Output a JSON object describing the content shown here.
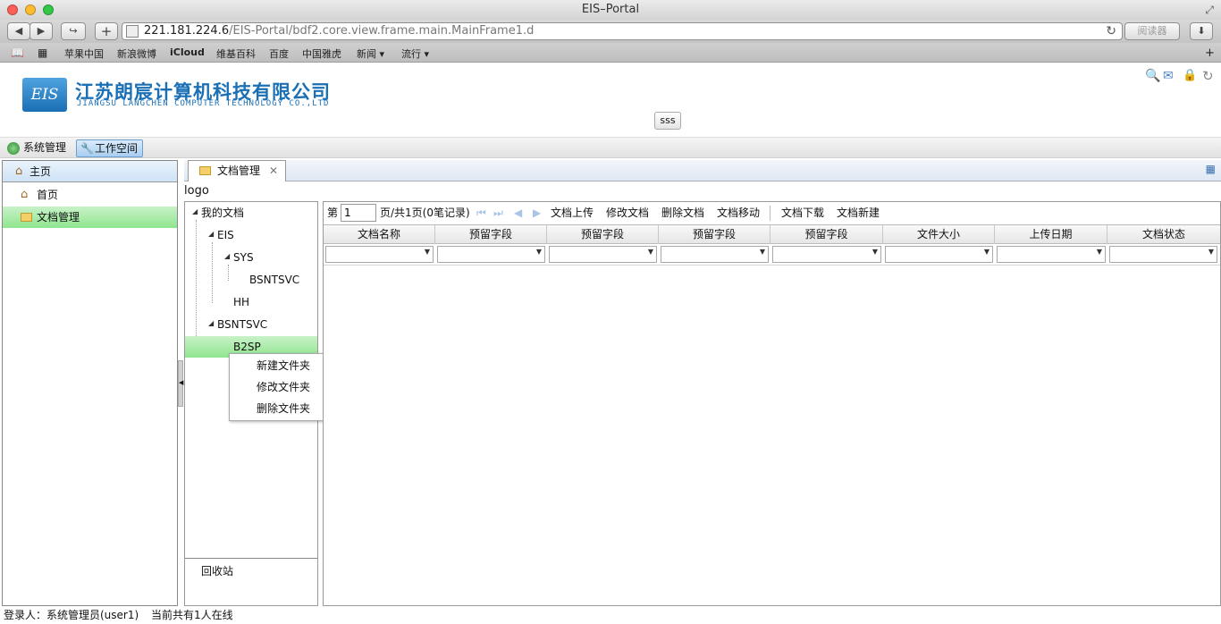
{
  "window": {
    "title": "EIS–Portal"
  },
  "browser": {
    "url_host": "221.181.224.6",
    "url_path": "/EIS-Portal/bdf2.core.view.frame.main.MainFrame1.d",
    "reader_label": "阅读器",
    "bookmarks": [
      {
        "label": "苹果中国"
      },
      {
        "label": "新浪微博"
      },
      {
        "label": "iCloud"
      },
      {
        "label": "维基百科"
      },
      {
        "label": "百度"
      },
      {
        "label": "中国雅虎"
      },
      {
        "label": "新闻 ▾"
      },
      {
        "label": "流行 ▾"
      }
    ]
  },
  "header": {
    "logo_text": "EIS",
    "company_cn": "江苏朗宸计算机科技有限公司",
    "company_en": "JIANGSU LANGCHEN COMPUTER TECHNOLOGY CO.,LTD",
    "center_button": "sss"
  },
  "nav": {
    "system_mgmt": "系统管理",
    "workspace": "工作空间"
  },
  "left_panel": {
    "title": "主页",
    "items": [
      {
        "label": "首页"
      },
      {
        "label": "文档管理"
      }
    ]
  },
  "tab": {
    "label": "文档管理"
  },
  "content": {
    "logo": "logo",
    "tree": {
      "root": "我的文档",
      "eis": "EIS",
      "sys": "SYS",
      "bsntsvc_child": "BSNTSVC",
      "hh": "HH",
      "bsntsvc": "BSNTSVC",
      "b2sp": "B2SP"
    },
    "recycle": "回收站",
    "context_menu": [
      {
        "label": "新建文件夹"
      },
      {
        "label": "修改文件夹"
      },
      {
        "label": "删除文件夹"
      }
    ],
    "pager": {
      "prefix": "第",
      "page_value": "1",
      "suffix": "页/共1页(0笔记录)"
    },
    "actions": {
      "upload": "文档上传",
      "edit": "修改文档",
      "delete": "删除文档",
      "move": "文档移动",
      "download": "文档下载",
      "new": "文档新建"
    },
    "columns": [
      {
        "label": "文档名称"
      },
      {
        "label": "预留字段"
      },
      {
        "label": "预留字段"
      },
      {
        "label": "预留字段"
      },
      {
        "label": "预留字段"
      },
      {
        "label": "文件大小"
      },
      {
        "label": "上传日期"
      },
      {
        "label": "文档状态"
      }
    ]
  },
  "status": {
    "login": "登录人：系统管理员(user1)",
    "online": "当前共有1人在线"
  },
  "colors": {
    "brand_blue": "#1a6fb5",
    "selection_green": "#8fe58f",
    "header_blue": "#cfe2f6"
  }
}
